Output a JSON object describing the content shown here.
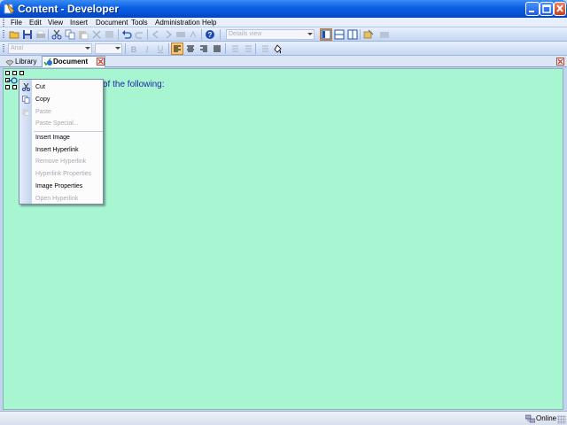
{
  "window": {
    "title": "Content - Developer",
    "accent": "#0a5fe0"
  },
  "menubar": {
    "items": [
      "File",
      "Edit",
      "View",
      "Insert",
      "Document",
      "Tools",
      "Administration",
      "Help"
    ]
  },
  "toolbar1": {
    "view_combo": "Details view",
    "icons": [
      "open-icon",
      "save-icon",
      "cut-icon",
      "copy-icon",
      "paste-icon",
      "delete-icon",
      "undo-icon",
      "redo-icon",
      "help-icon",
      "tile-view-icon",
      "horizontal-split-icon",
      "vertical-split-icon",
      "properties-icon",
      "refresh-icon"
    ]
  },
  "toolbar2": {
    "font_combo": "Arial",
    "size_combo": "",
    "icons": [
      "bold-icon",
      "italic-icon",
      "underline-icon",
      "align-left-icon",
      "align-center-icon",
      "align-right-icon",
      "justify-icon",
      "numbered-list-icon",
      "bullet-list-icon",
      "outdent-icon",
      "fill-icon"
    ]
  },
  "tabs": {
    "library": "Library",
    "document": "Document"
  },
  "editor": {
    "text": "of the following:",
    "background": "#a8f5d2"
  },
  "context_menu": {
    "items": [
      {
        "label": "Cut",
        "enabled": true,
        "icon": "scissors-icon"
      },
      {
        "label": "Copy",
        "enabled": true,
        "icon": "copy-icon"
      },
      {
        "label": "Paste",
        "enabled": false,
        "icon": "paste-icon"
      },
      {
        "label": "Paste Special...",
        "enabled": false,
        "icon": ""
      },
      {
        "label": "Insert Image",
        "enabled": true,
        "icon": ""
      },
      {
        "label": "Insert Hyperlink",
        "enabled": true,
        "icon": ""
      },
      {
        "label": "Remove Hyperlink",
        "enabled": false,
        "icon": ""
      },
      {
        "label": "Hyperlink Properties",
        "enabled": false,
        "icon": ""
      },
      {
        "label": "Image Properties",
        "enabled": true,
        "icon": ""
      },
      {
        "label": "Open Hyperlink",
        "enabled": false,
        "icon": ""
      }
    ]
  },
  "statusbar": {
    "status": "Online"
  }
}
